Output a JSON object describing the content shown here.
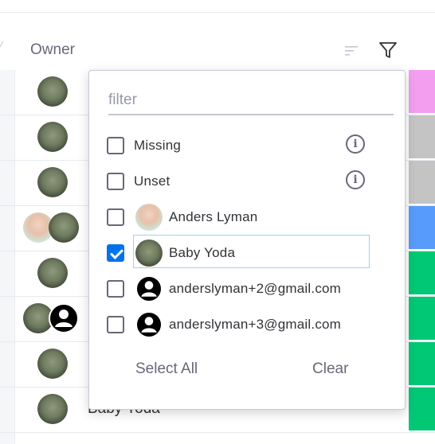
{
  "header": {
    "column_title": "Owner",
    "sort_icon": "sort-icon",
    "filter_icon": "filter-funnel-icon"
  },
  "rows": [
    {
      "owners": [
        "yoda"
      ],
      "status_color": "#f49ef0"
    },
    {
      "owners": [
        "yoda"
      ],
      "status_color": "#c4c4c4"
    },
    {
      "owners": [
        "yoda"
      ],
      "status_color": "#c4c4c4"
    },
    {
      "owners": [
        "person",
        "yoda"
      ],
      "status_color": "#579bfc"
    },
    {
      "owners": [
        "yoda"
      ],
      "status_color": "#00c875"
    },
    {
      "owners": [
        "yoda",
        "blackuser"
      ],
      "status_color": "#00c875"
    },
    {
      "owners": [
        "yoda"
      ],
      "status_color": "#00c875"
    },
    {
      "owners": [
        "yoda"
      ],
      "status_color": "#00c875",
      "text": "Baby Yoda"
    }
  ],
  "dropdown": {
    "placeholder": "filter",
    "options": [
      {
        "label": "Missing",
        "checked": false,
        "info": true
      },
      {
        "label": "Unset",
        "checked": false,
        "info": true
      },
      {
        "label": "Anders Lyman",
        "checked": false,
        "avatar": "person"
      },
      {
        "label": "Baby Yoda",
        "checked": true,
        "avatar": "yoda"
      },
      {
        "label": "anderslyman+2@gmail.com",
        "checked": false,
        "avatar": "blackuser"
      },
      {
        "label": "anderslyman+3@gmail.com",
        "checked": false,
        "avatar": "blackuser"
      }
    ],
    "select_all_label": "Select All",
    "clear_label": "Clear"
  }
}
